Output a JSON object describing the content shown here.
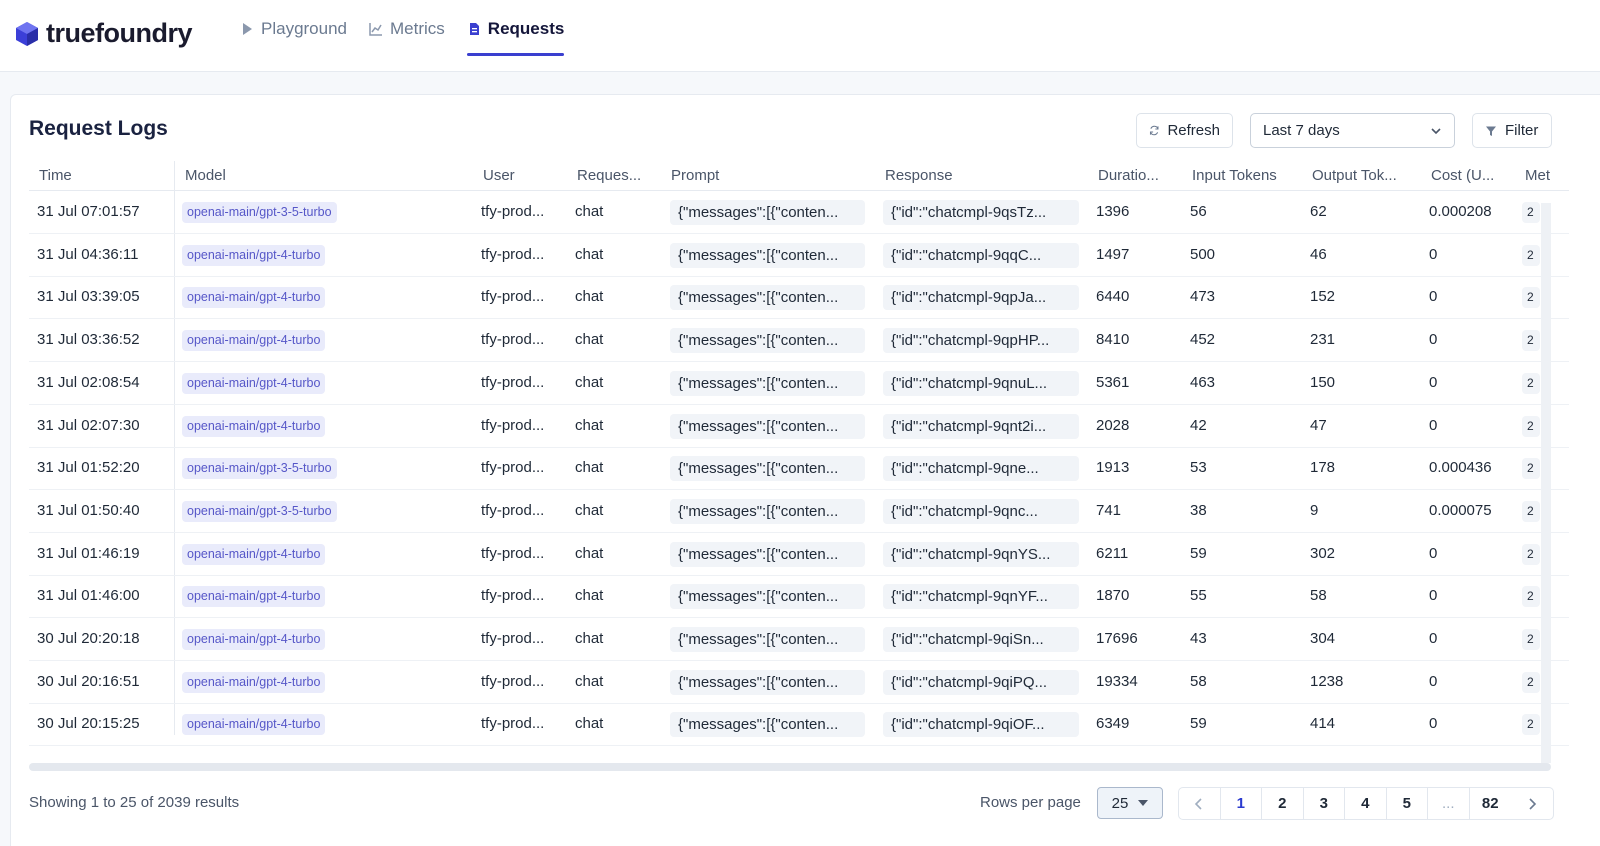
{
  "app": {
    "brand": "truefoundry"
  },
  "nav": [
    {
      "label": "Playground",
      "icon": "play-icon",
      "active": false
    },
    {
      "label": "Metrics",
      "icon": "chart-icon",
      "active": false
    },
    {
      "label": "Requests",
      "icon": "document-icon",
      "active": true
    }
  ],
  "page": {
    "title": "Request Logs",
    "refresh_label": "Refresh",
    "range_value": "Last 7 days",
    "filter_label": "Filter"
  },
  "table": {
    "columns": [
      "Time",
      "Model",
      "User",
      "Reques...",
      "Prompt",
      "Response",
      "Duratio...",
      "Input Tokens",
      "Output Tok...",
      "Cost (U...",
      "Met"
    ],
    "rows": [
      {
        "time": "31 Jul 07:01:57",
        "model": "openai-main/gpt-3-5-turbo",
        "user": "tfy-prod...",
        "type": "chat",
        "prompt": "{\"messages\":[{\"conten...",
        "response": "{\"id\":\"chatcmpl-9qsTz...",
        "duration": "1396",
        "input": "56",
        "output": "62",
        "cost": "0.000208",
        "meta": "2"
      },
      {
        "time": "31 Jul 04:36:11",
        "model": "openai-main/gpt-4-turbo",
        "user": "tfy-prod...",
        "type": "chat",
        "prompt": "{\"messages\":[{\"conten...",
        "response": "{\"id\":\"chatcmpl-9qqC...",
        "duration": "1497",
        "input": "500",
        "output": "46",
        "cost": "0",
        "meta": "2"
      },
      {
        "time": "31 Jul 03:39:05",
        "model": "openai-main/gpt-4-turbo",
        "user": "tfy-prod...",
        "type": "chat",
        "prompt": "{\"messages\":[{\"conten...",
        "response": "{\"id\":\"chatcmpl-9qpJa...",
        "duration": "6440",
        "input": "473",
        "output": "152",
        "cost": "0",
        "meta": "2"
      },
      {
        "time": "31 Jul 03:36:52",
        "model": "openai-main/gpt-4-turbo",
        "user": "tfy-prod...",
        "type": "chat",
        "prompt": "{\"messages\":[{\"conten...",
        "response": "{\"id\":\"chatcmpl-9qpHP...",
        "duration": "8410",
        "input": "452",
        "output": "231",
        "cost": "0",
        "meta": "2"
      },
      {
        "time": "31 Jul 02:08:54",
        "model": "openai-main/gpt-4-turbo",
        "user": "tfy-prod...",
        "type": "chat",
        "prompt": "{\"messages\":[{\"conten...",
        "response": "{\"id\":\"chatcmpl-9qnuL...",
        "duration": "5361",
        "input": "463",
        "output": "150",
        "cost": "0",
        "meta": "2"
      },
      {
        "time": "31 Jul 02:07:30",
        "model": "openai-main/gpt-4-turbo",
        "user": "tfy-prod...",
        "type": "chat",
        "prompt": "{\"messages\":[{\"conten...",
        "response": "{\"id\":\"chatcmpl-9qnt2i...",
        "duration": "2028",
        "input": "42",
        "output": "47",
        "cost": "0",
        "meta": "2"
      },
      {
        "time": "31 Jul 01:52:20",
        "model": "openai-main/gpt-3-5-turbo",
        "user": "tfy-prod...",
        "type": "chat",
        "prompt": "{\"messages\":[{\"conten...",
        "response": "{\"id\":\"chatcmpl-9qne...",
        "duration": "1913",
        "input": "53",
        "output": "178",
        "cost": "0.000436",
        "meta": "2"
      },
      {
        "time": "31 Jul 01:50:40",
        "model": "openai-main/gpt-3-5-turbo",
        "user": "tfy-prod...",
        "type": "chat",
        "prompt": "{\"messages\":[{\"conten...",
        "response": "{\"id\":\"chatcmpl-9qnc...",
        "duration": "741",
        "input": "38",
        "output": "9",
        "cost": "0.000075",
        "meta": "2"
      },
      {
        "time": "31 Jul 01:46:19",
        "model": "openai-main/gpt-4-turbo",
        "user": "tfy-prod...",
        "type": "chat",
        "prompt": "{\"messages\":[{\"conten...",
        "response": "{\"id\":\"chatcmpl-9qnYS...",
        "duration": "6211",
        "input": "59",
        "output": "302",
        "cost": "0",
        "meta": "2"
      },
      {
        "time": "31 Jul 01:46:00",
        "model": "openai-main/gpt-4-turbo",
        "user": "tfy-prod...",
        "type": "chat",
        "prompt": "{\"messages\":[{\"conten...",
        "response": "{\"id\":\"chatcmpl-9qnYF...",
        "duration": "1870",
        "input": "55",
        "output": "58",
        "cost": "0",
        "meta": "2"
      },
      {
        "time": "30 Jul 20:20:18",
        "model": "openai-main/gpt-4-turbo",
        "user": "tfy-prod...",
        "type": "chat",
        "prompt": "{\"messages\":[{\"conten...",
        "response": "{\"id\":\"chatcmpl-9qiSn...",
        "duration": "17696",
        "input": "43",
        "output": "304",
        "cost": "0",
        "meta": "2"
      },
      {
        "time": "30 Jul 20:16:51",
        "model": "openai-main/gpt-4-turbo",
        "user": "tfy-prod...",
        "type": "chat",
        "prompt": "{\"messages\":[{\"conten...",
        "response": "{\"id\":\"chatcmpl-9qiPQ...",
        "duration": "19334",
        "input": "58",
        "output": "1238",
        "cost": "0",
        "meta": "2"
      },
      {
        "time": "30 Jul 20:15:25",
        "model": "openai-main/gpt-4-turbo",
        "user": "tfy-prod...",
        "type": "chat",
        "prompt": "{\"messages\":[{\"conten...",
        "response": "{\"id\":\"chatcmpl-9qiOF...",
        "duration": "6349",
        "input": "59",
        "output": "414",
        "cost": "0",
        "meta": "2"
      }
    ]
  },
  "footer": {
    "summary": "Showing 1 to 25 of 2039 results",
    "rows_per_page_label": "Rows per page",
    "rows_per_page_value": "25",
    "pages": [
      "1",
      "2",
      "3",
      "4",
      "5",
      "...",
      "82"
    ],
    "current_page": "1"
  },
  "colors": {
    "accent": "#3a3fcf",
    "badge_bg": "#e9ebfb",
    "badge_text": "#5657c8"
  }
}
